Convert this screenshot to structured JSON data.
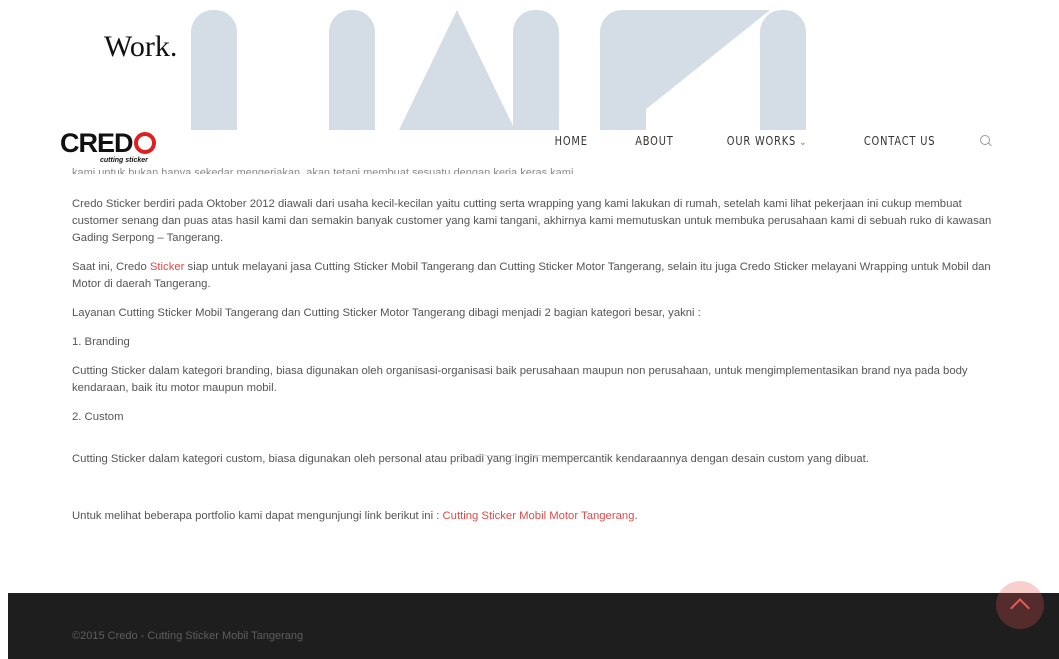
{
  "watermark": {
    "heading": "Work."
  },
  "header": {
    "logo": {
      "word": "CRED",
      "sub": "cutting sticker"
    },
    "nav": [
      {
        "label": "HOME"
      },
      {
        "label": "ABOUT"
      },
      {
        "label": "OUR WORKS",
        "has_dropdown": true
      },
      {
        "label": "CONTACT US"
      }
    ],
    "search_icon": "search-icon"
  },
  "content": {
    "clipped_line": "kami untuk bukan hanya sekedar mengerjakan, akan tetapi membuat sesuatu dengan kerja keras kami.",
    "p1": "Credo Sticker berdiri pada Oktober 2012 diawali dari usaha kecil-kecilan yaitu cutting serta wrapping yang kami lakukan di rumah, setelah kami lihat pekerjaan ini cukup membuat customer senang dan puas atas hasil kami dan semakin banyak customer yang kami tangani, akhirnya kami memutuskan untuk membuka perusahaan kami di sebuah ruko di kawasan Gading Serpong – Tangerang.",
    "p2_before": "Saat ini, Credo ",
    "p2_link": "Sticker",
    "p2_after": " siap untuk melayani jasa Cutting Sticker Mobil Tangerang dan Cutting Sticker Motor Tangerang, selain itu juga Credo Sticker melayani Wrapping untuk Mobil dan Motor di daerah Tangerang.",
    "p3": "Layanan Cutting Sticker Mobil Tangerang dan Cutting Sticker Motor Tangerang dibagi menjadi 2 bagian kategori besar, yakni :",
    "p4": "1. Branding",
    "p5": "Cutting Sticker dalam kategori branding, biasa digunakan oleh organisasi-organisasi baik perusahaan maupun non perusahaan, untuk mengimplementasikan brand nya pada body kendaraan, baik itu motor maupun mobil.",
    "p6": "2. Custom",
    "p7": "Cutting Sticker dalam kategori custom, biasa digunakan oleh personal atau pribadi yang ingin mempercantik kendaraannya dengan desain custom yang dibuat.",
    "p8_before": "Untuk melihat beberapa portfolio kami dapat mengunjungi link berikut ini : ",
    "p8_link": "Cutting Sticker Mobil Motor Tangerang",
    "p8_after": "."
  },
  "footer": {
    "copyright": "©2015 Credo - Cutting Sticker Mobil Tangerang"
  },
  "colors": {
    "accent": "#e54848",
    "footer_bg": "#1e1e1e",
    "watermark": "#d4dde6"
  }
}
